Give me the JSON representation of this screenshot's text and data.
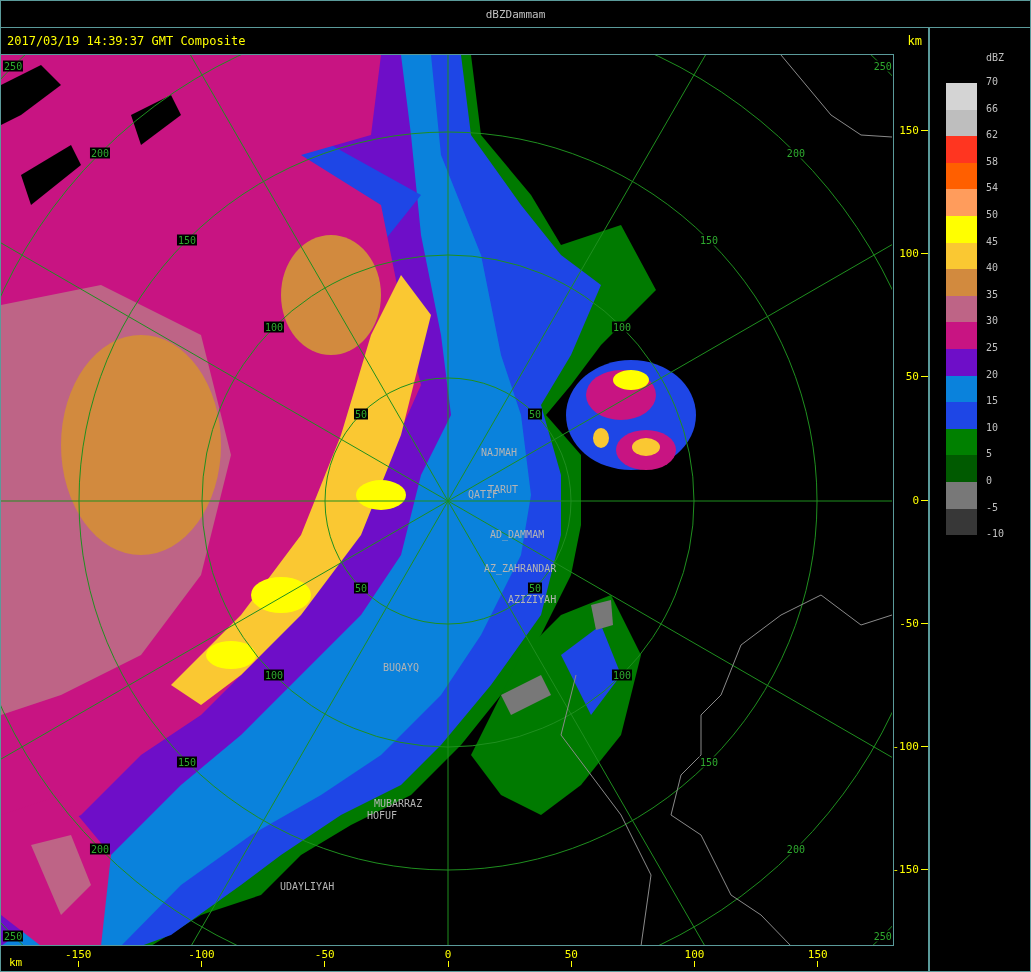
{
  "window": {
    "title": "dBZDammam"
  },
  "header": {
    "timestamp": "2017/03/19 14:39:37 GMT Composite",
    "unit": "km"
  },
  "map": {
    "ring_labels": {
      "northwest": [
        "50",
        "100",
        "150",
        "200",
        "250"
      ],
      "northeast": [
        "50",
        "100",
        "150",
        "200",
        "250"
      ],
      "southwest": [
        "50",
        "100",
        "150",
        "200",
        "250"
      ],
      "southeast": [
        "50",
        "100",
        "150",
        "200",
        "250"
      ]
    },
    "places": [
      {
        "name": "NAJMAH"
      },
      {
        "name": "TARUT"
      },
      {
        "name": "QATIF"
      },
      {
        "name": "AD_DAMMAM"
      },
      {
        "name": "AZ_ZAHRANDAR"
      },
      {
        "name": "AZIZIYAH"
      },
      {
        "name": "BUQAYQ"
      },
      {
        "name": "MUBARRAZ"
      },
      {
        "name": "HOFUF"
      },
      {
        "name": "UDAYLIYAH"
      }
    ]
  },
  "y_axis": {
    "ticks": [
      "150",
      "100",
      "50",
      "0",
      "-50",
      "-100",
      "-150"
    ]
  },
  "x_axis": {
    "unit": "km",
    "ticks": [
      "-150",
      "-100",
      "-50",
      "0",
      "50",
      "100",
      "150"
    ]
  },
  "legend": {
    "title": "dBZ",
    "bins": [
      {
        "label": "70",
        "color": "#d4d4d4"
      },
      {
        "label": "66",
        "color": "#bebebe"
      },
      {
        "label": "62",
        "color": "#ff3520"
      },
      {
        "label": "58",
        "color": "#ff5f00"
      },
      {
        "label": "54",
        "color": "#ff9c5c"
      },
      {
        "label": "50",
        "color": "#ffff00"
      },
      {
        "label": "45",
        "color": "#fac832"
      },
      {
        "label": "40",
        "color": "#d28a3e"
      },
      {
        "label": "35",
        "color": "#be6486"
      },
      {
        "label": "30",
        "color": "#c81482"
      },
      {
        "label": "25",
        "color": "#6e0ec8"
      },
      {
        "label": "20",
        "color": "#0a82dc"
      },
      {
        "label": "15",
        "color": "#1e46e6"
      },
      {
        "label": "10",
        "color": "#008000"
      },
      {
        "label": "5",
        "color": "#005a00"
      },
      {
        "label": "0",
        "color": "#787878"
      },
      {
        "label": "-5",
        "color": "#373737"
      }
    ],
    "last_label": "-10"
  }
}
